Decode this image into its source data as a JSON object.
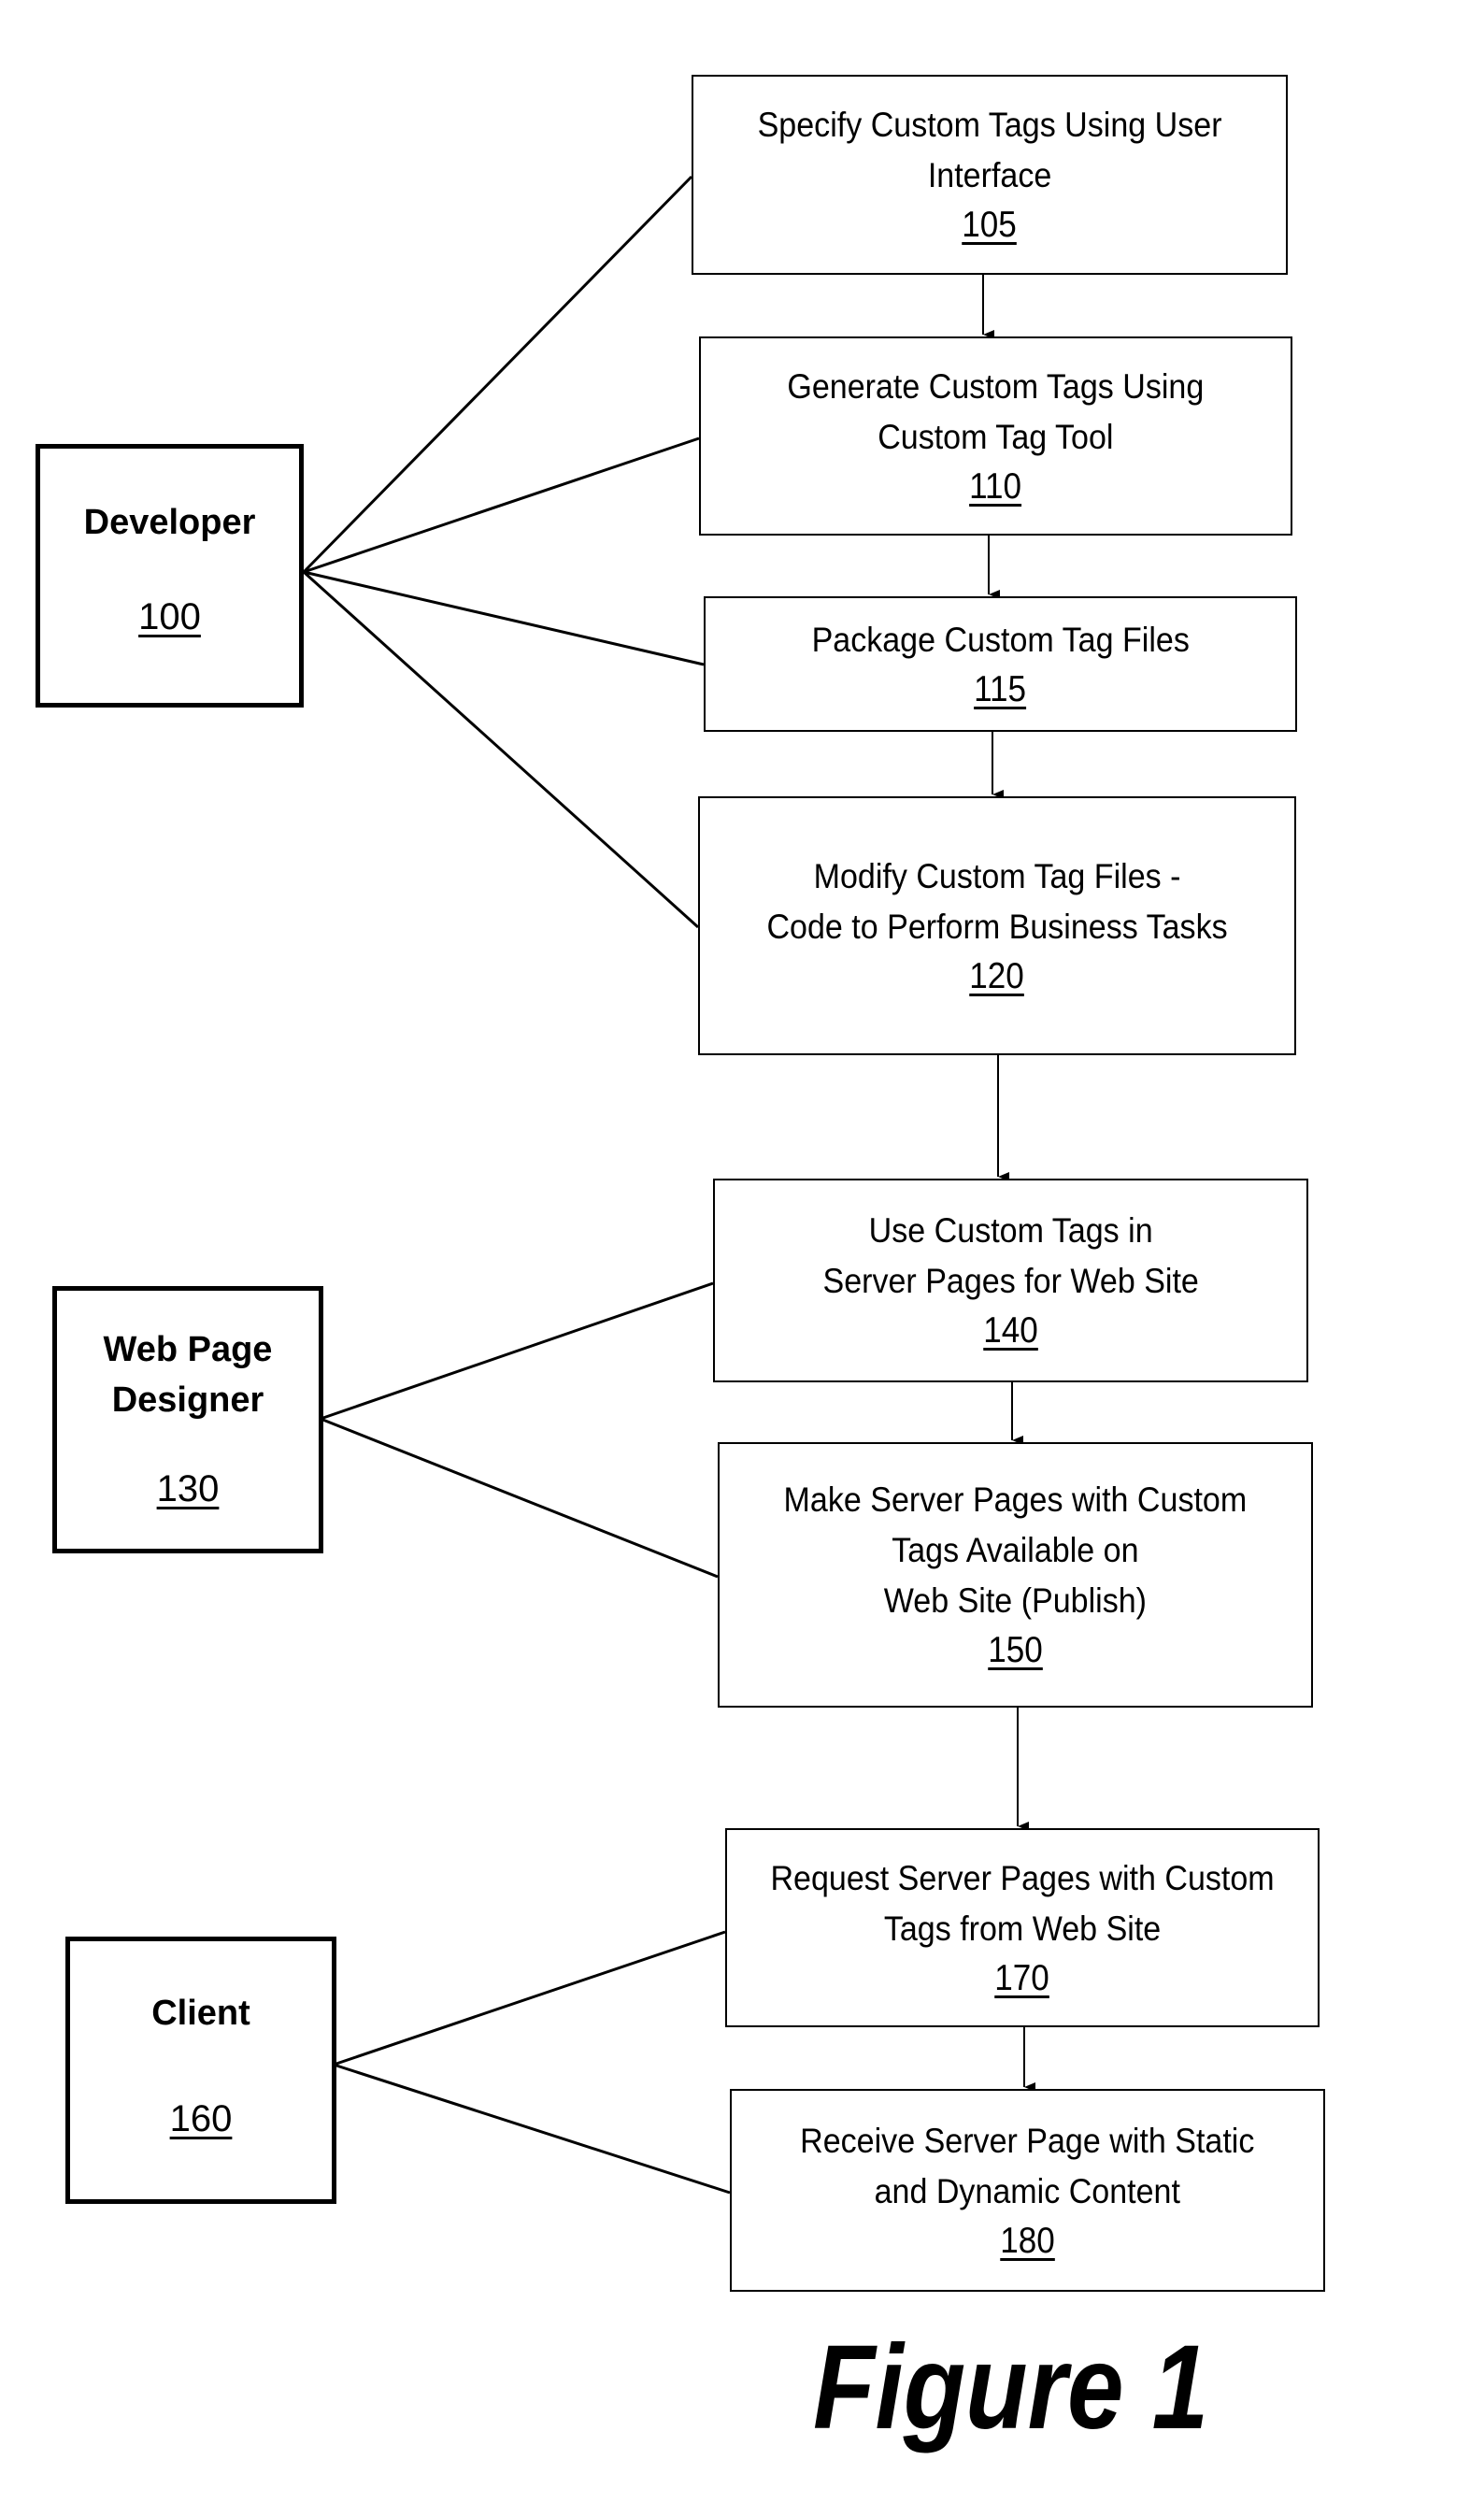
{
  "figure": {
    "caption": "Figure 1"
  },
  "actors": [
    {
      "id": "developer",
      "label": "Developer",
      "number": "100"
    },
    {
      "id": "web-page-designer",
      "label": "Web Page\nDesigner",
      "number": "130"
    },
    {
      "id": "client",
      "label": "Client",
      "number": "160"
    }
  ],
  "steps": [
    {
      "id": "105",
      "label": "Specify Custom Tags Using User\nInterface",
      "number": "105",
      "actor": "developer"
    },
    {
      "id": "110",
      "label": "Generate Custom Tags Using\nCustom Tag Tool",
      "number": "110",
      "actor": "developer"
    },
    {
      "id": "115",
      "label": "Package Custom Tag Files",
      "number": "115",
      "actor": "developer"
    },
    {
      "id": "120",
      "label": "Modify Custom Tag Files -\nCode to Perform Business Tasks",
      "number": "120",
      "actor": "developer"
    },
    {
      "id": "140",
      "label": "Use Custom Tags in\nServer Pages for Web Site",
      "number": "140",
      "actor": "web-page-designer"
    },
    {
      "id": "150",
      "label": "Make Server Pages with Custom\nTags Available on\nWeb Site (Publish)",
      "number": "150",
      "actor": "web-page-designer"
    },
    {
      "id": "170",
      "label": "Request Server Pages with Custom\nTags from Web Site",
      "number": "170",
      "actor": "client"
    },
    {
      "id": "180",
      "label": "Receive Server Page with Static\nand Dynamic Content",
      "number": "180",
      "actor": "client"
    }
  ],
  "flow": [
    [
      "105",
      "110"
    ],
    [
      "110",
      "115"
    ],
    [
      "115",
      "120"
    ],
    [
      "120",
      "140"
    ],
    [
      "140",
      "150"
    ],
    [
      "150",
      "170"
    ],
    [
      "170",
      "180"
    ]
  ]
}
